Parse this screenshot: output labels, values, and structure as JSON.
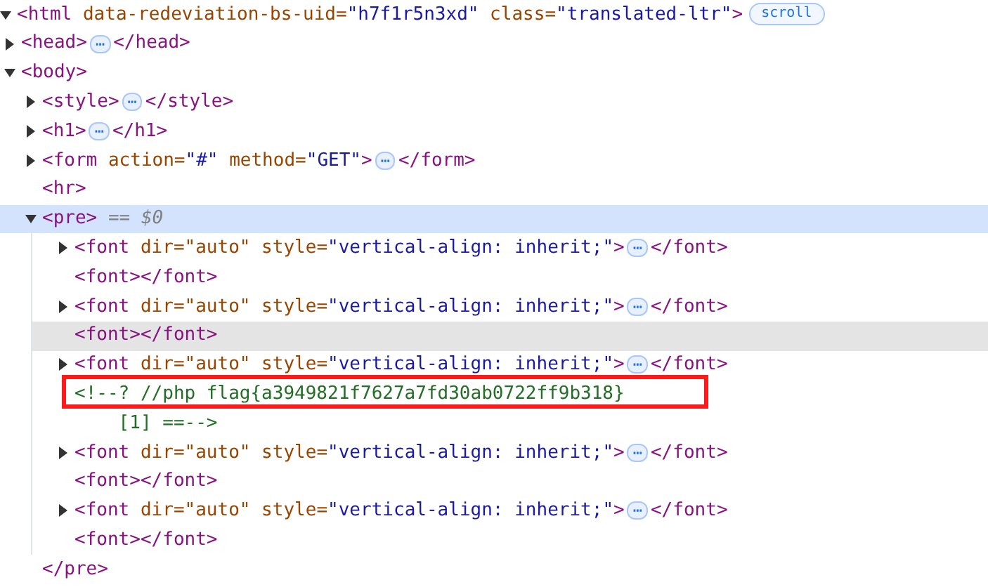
{
  "dom_tree": [
    {
      "kind": "element",
      "expanded": true,
      "selected": false,
      "hovered": false,
      "tokens": [
        {
          "kind": "tag",
          "text": "<html"
        },
        {
          "kind": "attr",
          "text": " data-redeviation-bs-uid="
        },
        {
          "kind": "value",
          "text": "\"h7f1r5n3xd\""
        },
        {
          "kind": "attr",
          "text": " class="
        },
        {
          "kind": "value",
          "text": "\"translated-ltr\""
        },
        {
          "kind": "tag",
          "text": ">"
        },
        {
          "kind": "badge",
          "text": "scroll"
        }
      ],
      "children": [
        {
          "kind": "element",
          "expanded": false,
          "selected": false,
          "hovered": false,
          "tokens": [
            {
              "kind": "tag",
              "text": "<head>"
            },
            {
              "kind": "ellipsis",
              "text": "⋯"
            },
            {
              "kind": "tag",
              "text": "</head>"
            }
          ]
        },
        {
          "kind": "element",
          "expanded": true,
          "selected": false,
          "hovered": false,
          "tokens": [
            {
              "kind": "tag",
              "text": "<body>"
            }
          ],
          "children": [
            {
              "kind": "element",
              "expanded": false,
              "selected": false,
              "hovered": false,
              "tokens": [
                {
                  "kind": "tag",
                  "text": "<style>"
                },
                {
                  "kind": "ellipsis",
                  "text": "⋯"
                },
                {
                  "kind": "tag",
                  "text": "</style>"
                }
              ]
            },
            {
              "kind": "element",
              "expanded": false,
              "selected": false,
              "hovered": false,
              "tokens": [
                {
                  "kind": "tag",
                  "text": "<h1>"
                },
                {
                  "kind": "ellipsis",
                  "text": "⋯"
                },
                {
                  "kind": "tag",
                  "text": "</h1>"
                }
              ]
            },
            {
              "kind": "element",
              "expanded": false,
              "selected": false,
              "hovered": false,
              "tokens": [
                {
                  "kind": "tag",
                  "text": "<form"
                },
                {
                  "kind": "attr",
                  "text": " action="
                },
                {
                  "kind": "value",
                  "text": "\"#\""
                },
                {
                  "kind": "attr",
                  "text": " method="
                },
                {
                  "kind": "value",
                  "text": "\"GET\""
                },
                {
                  "kind": "tag",
                  "text": ">"
                },
                {
                  "kind": "ellipsis",
                  "text": "⋯"
                },
                {
                  "kind": "tag",
                  "text": "</form>"
                }
              ]
            },
            {
              "kind": "leaf",
              "selected": false,
              "hovered": false,
              "tokens": [
                {
                  "kind": "tag",
                  "text": "<hr>"
                }
              ]
            },
            {
              "kind": "element",
              "expanded": true,
              "selected": true,
              "hovered": false,
              "tokens": [
                {
                  "kind": "tag",
                  "text": "<pre>"
                },
                {
                  "kind": "note",
                  "text": " == $0"
                }
              ],
              "closing": [
                {
                  "kind": "tag",
                  "text": "</pre>"
                }
              ],
              "children": [
                {
                  "kind": "element",
                  "expanded": false,
                  "selected": false,
                  "hovered": false,
                  "tokens": [
                    {
                      "kind": "tag",
                      "text": "<font"
                    },
                    {
                      "kind": "attr",
                      "text": " dir=\"auto\""
                    },
                    {
                      "kind": "attr",
                      "text": " style="
                    },
                    {
                      "kind": "value",
                      "text": "\"vertical-align: inherit;\""
                    },
                    {
                      "kind": "tag",
                      "text": ">"
                    },
                    {
                      "kind": "ellipsis",
                      "text": "⋯"
                    },
                    {
                      "kind": "tag",
                      "text": "</font>"
                    }
                  ]
                },
                {
                  "kind": "leaf",
                  "selected": false,
                  "hovered": false,
                  "tokens": [
                    {
                      "kind": "tag",
                      "text": "<font></font>"
                    }
                  ]
                },
                {
                  "kind": "element",
                  "expanded": false,
                  "selected": false,
                  "hovered": false,
                  "tokens": [
                    {
                      "kind": "tag",
                      "text": "<font"
                    },
                    {
                      "kind": "attr",
                      "text": " dir=\"auto\""
                    },
                    {
                      "kind": "attr",
                      "text": " style="
                    },
                    {
                      "kind": "value",
                      "text": "\"vertical-align: inherit;\""
                    },
                    {
                      "kind": "tag",
                      "text": ">"
                    },
                    {
                      "kind": "ellipsis",
                      "text": "⋯"
                    },
                    {
                      "kind": "tag",
                      "text": "</font>"
                    }
                  ]
                },
                {
                  "kind": "leaf",
                  "selected": false,
                  "hovered": true,
                  "tokens": [
                    {
                      "kind": "tag",
                      "text": "<font></font>"
                    }
                  ]
                },
                {
                  "kind": "element",
                  "expanded": false,
                  "selected": false,
                  "hovered": false,
                  "tokens": [
                    {
                      "kind": "tag",
                      "text": "<font"
                    },
                    {
                      "kind": "attr",
                      "text": " dir=\"auto\""
                    },
                    {
                      "kind": "attr",
                      "text": " style="
                    },
                    {
                      "kind": "value",
                      "text": "\"vertical-align: inherit;\""
                    },
                    {
                      "kind": "tag",
                      "text": ">"
                    },
                    {
                      "kind": "ellipsis",
                      "text": "⋯"
                    },
                    {
                      "kind": "tag",
                      "text": "</font>"
                    }
                  ]
                },
                {
                  "kind": "comment",
                  "selected": false,
                  "hovered": false,
                  "highlighted": true,
                  "lines": [
                    "<!--? //php flag{a3949821f7627a7fd30ab0722ff9b318}",
                    "    [1] ==-->"
                  ]
                },
                {
                  "kind": "element",
                  "expanded": false,
                  "selected": false,
                  "hovered": false,
                  "tokens": [
                    {
                      "kind": "tag",
                      "text": "<font"
                    },
                    {
                      "kind": "attr",
                      "text": " dir=\"auto\""
                    },
                    {
                      "kind": "attr",
                      "text": " style="
                    },
                    {
                      "kind": "value",
                      "text": "\"vertical-align: inherit;\""
                    },
                    {
                      "kind": "tag",
                      "text": ">"
                    },
                    {
                      "kind": "ellipsis",
                      "text": "⋯"
                    },
                    {
                      "kind": "tag",
                      "text": "</font>"
                    }
                  ]
                },
                {
                  "kind": "leaf",
                  "selected": false,
                  "hovered": false,
                  "tokens": [
                    {
                      "kind": "tag",
                      "text": "<font></font>"
                    }
                  ]
                },
                {
                  "kind": "element",
                  "expanded": false,
                  "selected": false,
                  "hovered": false,
                  "tokens": [
                    {
                      "kind": "tag",
                      "text": "<font"
                    },
                    {
                      "kind": "attr",
                      "text": " dir=\"auto\""
                    },
                    {
                      "kind": "attr",
                      "text": " style="
                    },
                    {
                      "kind": "value",
                      "text": "\"vertical-align: inherit;\""
                    },
                    {
                      "kind": "tag",
                      "text": ">"
                    },
                    {
                      "kind": "ellipsis",
                      "text": "⋯"
                    },
                    {
                      "kind": "tag",
                      "text": "</font>"
                    }
                  ]
                },
                {
                  "kind": "leaf",
                  "selected": false,
                  "hovered": false,
                  "tokens": [
                    {
                      "kind": "tag",
                      "text": "<font></font>"
                    }
                  ]
                }
              ]
            }
          ]
        }
      ]
    }
  ]
}
